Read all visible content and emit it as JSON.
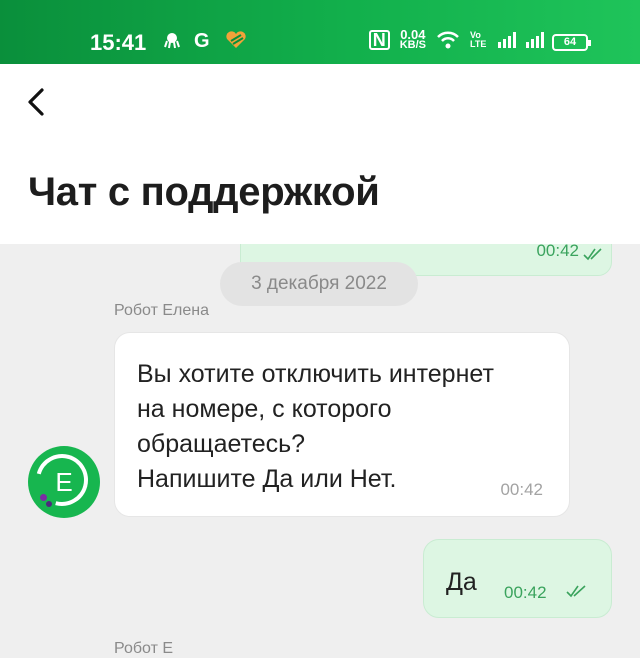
{
  "status_bar": {
    "time": "15:41",
    "left_icons": [
      "octopus-icon",
      "google-icon",
      "heart-app-icon"
    ],
    "nfc_label": "N",
    "speed_value": "0.04",
    "speed_unit": "KB/S",
    "volte_label": "Vo LTE",
    "battery": "64"
  },
  "header": {
    "back_icon": "chevron-left-icon",
    "title": "Чат с поддержкой"
  },
  "chat": {
    "previous_message_time": "00:42",
    "date_chip": "3 декабря 2022",
    "bot_name": "Робот Елена",
    "avatar_letter": "E",
    "bot_message": "Вы хотите отключить интернет\nна номере, с которого\nобращаетесь?\nНапишите Да или Нет.",
    "bot_time": "00:42",
    "user_message": "Да",
    "user_time": "00:42",
    "next_sender_partial": "Робот Е"
  },
  "colors": {
    "brand_green": "#12b04c",
    "user_bubble": "#ddf6e3",
    "background": "#efefef"
  }
}
